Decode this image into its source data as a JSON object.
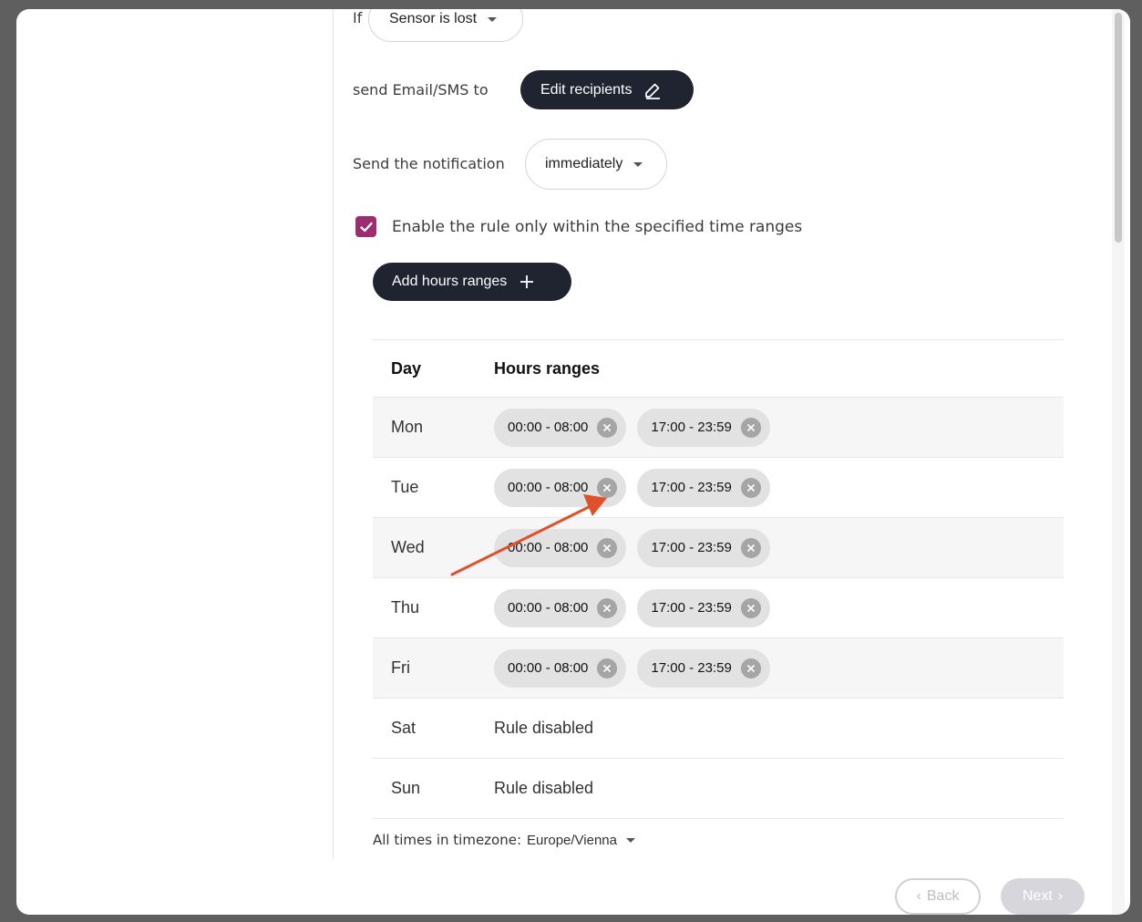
{
  "condition": {
    "prefix": "If",
    "value": "Sensor is lost"
  },
  "recipients": {
    "label": "send Email/SMS to",
    "button": "Edit recipients"
  },
  "timing": {
    "label": "Send the notification",
    "value": "immediately"
  },
  "time_restriction": {
    "checked": true,
    "label": "Enable the rule only within the specified time ranges"
  },
  "add_ranges_button": "Add hours ranges",
  "table": {
    "headers": {
      "day": "Day",
      "ranges": "Hours ranges"
    },
    "rows": [
      {
        "day": "Mon",
        "ranges": [
          "00:00 - 08:00",
          "17:00 - 23:59"
        ]
      },
      {
        "day": "Tue",
        "ranges": [
          "00:00 - 08:00",
          "17:00 - 23:59"
        ]
      },
      {
        "day": "Wed",
        "ranges": [
          "00:00 - 08:00",
          "17:00 - 23:59"
        ]
      },
      {
        "day": "Thu",
        "ranges": [
          "00:00 - 08:00",
          "17:00 - 23:59"
        ]
      },
      {
        "day": "Fri",
        "ranges": [
          "00:00 - 08:00",
          "17:00 - 23:59"
        ]
      },
      {
        "day": "Sat",
        "status": "Rule disabled"
      },
      {
        "day": "Sun",
        "status": "Rule disabled"
      }
    ]
  },
  "timezone": {
    "prefix": "All times in timezone:",
    "value": "Europe/Vienna"
  },
  "nav": {
    "back": "Back",
    "next": "Next"
  },
  "colors": {
    "accent": "#9b2d70",
    "dark_button": "#1f2430",
    "annotation_arrow": "#e0502a"
  }
}
